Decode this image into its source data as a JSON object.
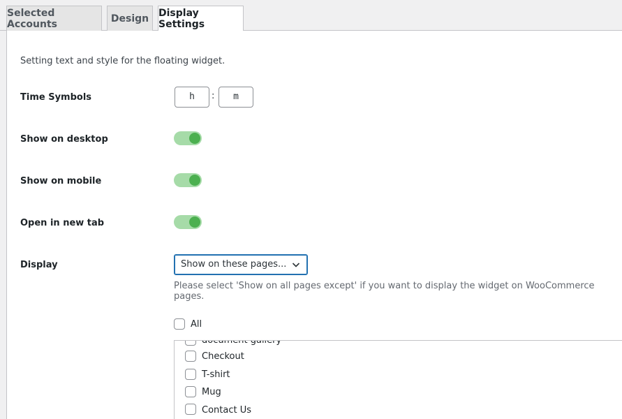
{
  "tabs": [
    {
      "label": "Selected Accounts"
    },
    {
      "label": "Design"
    },
    {
      "label": "Display Settings"
    }
  ],
  "description": "Setting text and style for the floating widget.",
  "time_symbols": {
    "label": "Time Symbols",
    "hours": "h",
    "separator": ":",
    "minutes": "m"
  },
  "show_desktop": {
    "label": "Show on desktop",
    "on": true
  },
  "show_mobile": {
    "label": "Show on mobile",
    "on": true
  },
  "open_new_tab": {
    "label": "Open in new tab",
    "on": true
  },
  "display": {
    "label": "Display",
    "selected": "Show on these pages...",
    "hint": "Please select 'Show on all pages except' if you want to display the widget on WooCommerce pages."
  },
  "pages": {
    "all_label": "All",
    "items": [
      "document gallery",
      "Checkout",
      "T-shirt",
      "Mug",
      "Contact Us"
    ]
  },
  "colors": {
    "toggle_track": "#a6dba8",
    "toggle_knob": "#4cb050",
    "focus": "#2271b1"
  }
}
